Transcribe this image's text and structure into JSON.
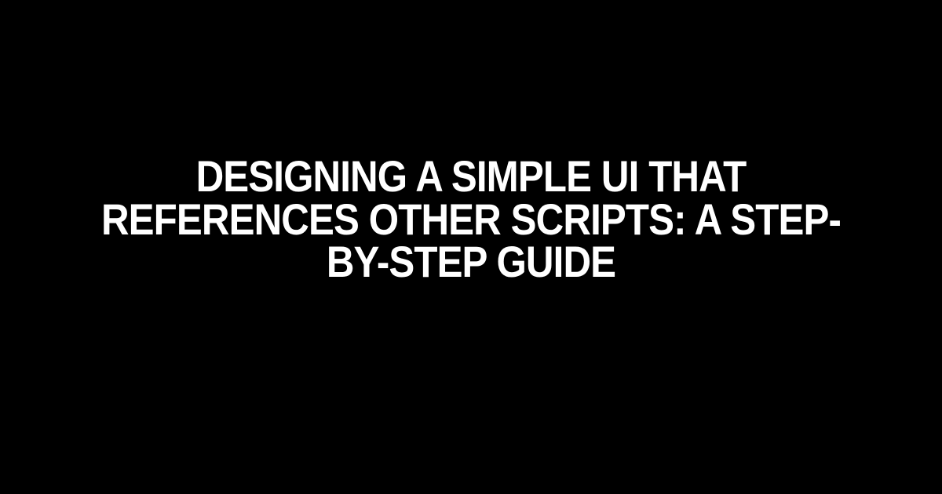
{
  "title": "Designing a Simple UI that References Other Scripts: A Step-by-Step Guide"
}
